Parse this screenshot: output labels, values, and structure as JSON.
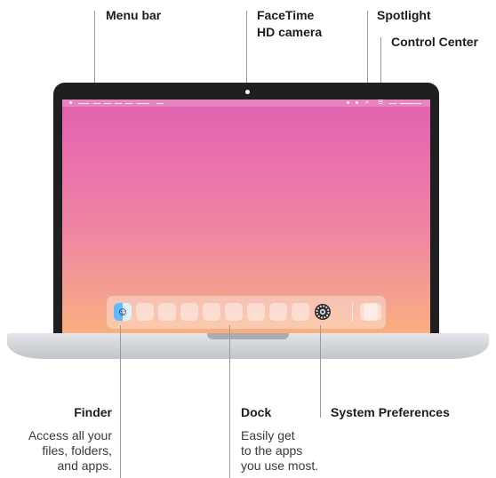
{
  "labels": {
    "menu_bar": "Menu bar",
    "facetime_line1": "FaceTime",
    "facetime_line2": "HD camera",
    "spotlight": "Spotlight",
    "control_center": "Control Center",
    "finder_title": "Finder",
    "finder_desc_1": "Access all your",
    "finder_desc_2": "files, folders,",
    "finder_desc_3": "and apps.",
    "dock_title": "Dock",
    "dock_desc_1": "Easily get",
    "dock_desc_2": "to the apps",
    "dock_desc_3": "you use most.",
    "system_preferences": "System Preferences"
  },
  "icons": {
    "finder": "finder-icon",
    "system_preferences": "gear-icon",
    "spotlight": "search-icon",
    "control_center": "control-center-icon",
    "camera": "camera-icon"
  },
  "colors": {
    "bezel": "#1f1f21",
    "wallpaper_top": "#e062b0",
    "wallpaper_bottom": "#f9b37c",
    "chassis": "#d2d5da",
    "leader_line": "#9a9a9a"
  },
  "dock": {
    "app_slots_before_separator": 10,
    "app_slots_after_separator": 2
  }
}
